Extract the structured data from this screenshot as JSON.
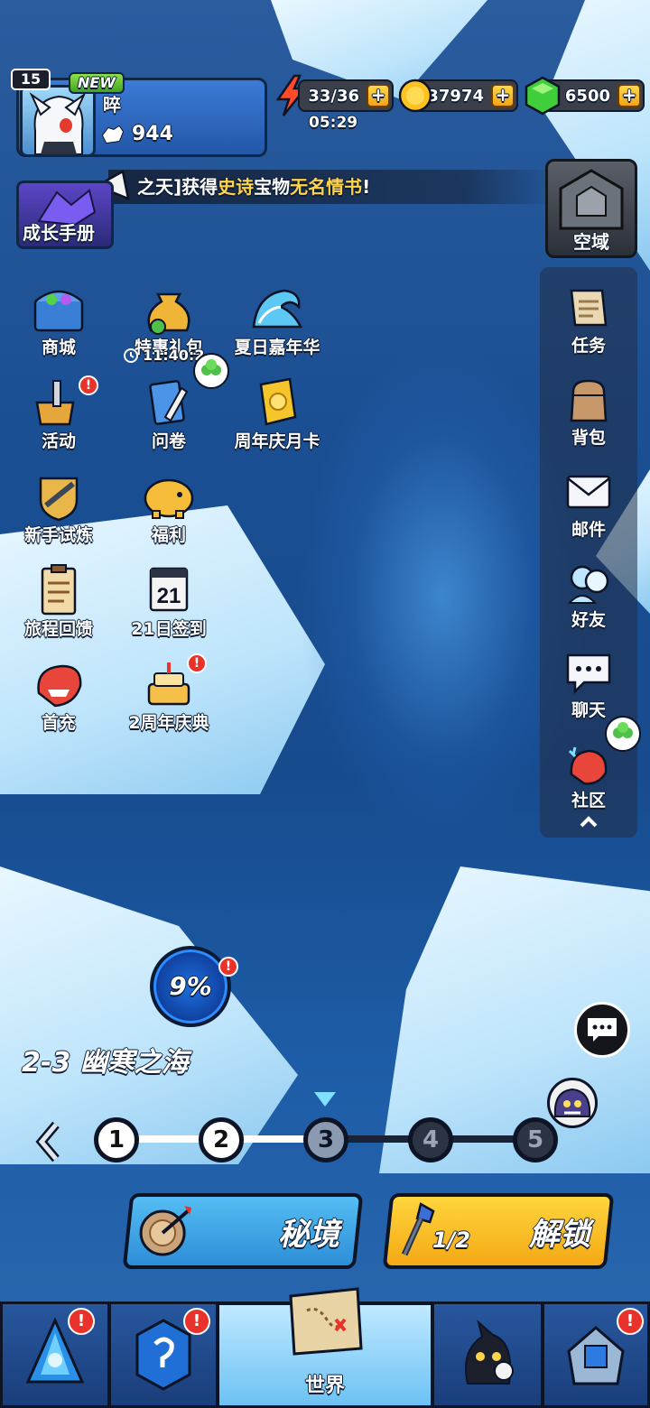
{
  "player": {
    "level": "15",
    "new_badge": "NEW",
    "name": "晬",
    "power": "944"
  },
  "resources": {
    "stamina": "33/36",
    "stamina_timer": "05:29",
    "gold": "37974",
    "gems": "6500"
  },
  "ticker": {
    "prefix": "之天]获得",
    "highlight": "史诗",
    "middle": "宝物",
    "highlight2": "无名情书",
    "suffix": "!"
  },
  "growth_manual": "成长手册",
  "kongyu": "空域",
  "left_menu": [
    {
      "label": "商城"
    },
    {
      "label": "特惠礼包"
    },
    {
      "label": "夏日嘉年华"
    },
    {
      "label": "活动"
    },
    {
      "label": "问卷"
    },
    {
      "label": "周年庆月卡"
    },
    {
      "label": "新手试炼"
    },
    {
      "label": "福利"
    },
    {
      "label": "旅程回馈"
    },
    {
      "label": "21日签到"
    },
    {
      "label": "首充"
    },
    {
      "label": "2周年庆典"
    }
  ],
  "gift_countdown": "11:40:2",
  "calendar_day": "21",
  "sidebar": [
    {
      "label": "任务"
    },
    {
      "label": "背包"
    },
    {
      "label": "邮件"
    },
    {
      "label": "好友"
    },
    {
      "label": "聊天"
    },
    {
      "label": "社区"
    }
  ],
  "stage": {
    "progress": "9%",
    "title": "2-3 幽寒之海",
    "nodes": [
      "1",
      "2",
      "3",
      "4",
      "5"
    ]
  },
  "buttons": {
    "secret": "秘境",
    "unlock": "解锁",
    "keys": "1/2"
  },
  "bottom_nav": {
    "world": "世界"
  },
  "badge_mark": "!",
  "colors": {
    "accent_yellow": "#ffd34a",
    "alert_red": "#e8322a",
    "gem_green": "#3fcf3a"
  }
}
